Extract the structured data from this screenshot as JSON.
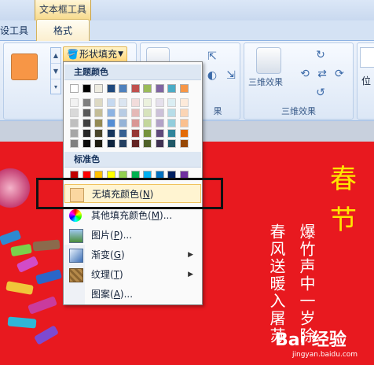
{
  "contextual_group": {
    "label": "文本框工具"
  },
  "tabs": {
    "left_partial": "设工具",
    "active": "格式"
  },
  "shape_fill": {
    "label": "形状填充",
    "swatch_color": "#f79646"
  },
  "ribbon_groups": {
    "shadow_label": "果",
    "three_d_label": "三维效果",
    "three_d_button": "三维效果",
    "position_button": "位"
  },
  "menu": {
    "theme_header": "主题颜色",
    "standard_header": "标准色",
    "theme_top_row": [
      "#ffffff",
      "#000000",
      "#eeece1",
      "#1f497d",
      "#4f81bd",
      "#c0504d",
      "#9bbb59",
      "#8064a2",
      "#4bacc6",
      "#f79646"
    ],
    "theme_columns": [
      [
        "#f2f2f2",
        "#d9d9d9",
        "#bfbfbf",
        "#a6a6a6",
        "#808080"
      ],
      [
        "#7f7f7f",
        "#595959",
        "#3f3f3f",
        "#262626",
        "#0c0c0c"
      ],
      [
        "#ddd9c3",
        "#c4bd97",
        "#948a54",
        "#4a452a",
        "#1e1c11"
      ],
      [
        "#c6d9f0",
        "#8db3e2",
        "#548dd4",
        "#17365d",
        "#0f243e"
      ],
      [
        "#dbe5f1",
        "#b8cce4",
        "#95b3d7",
        "#366092",
        "#244061"
      ],
      [
        "#f2dcdb",
        "#e5b9b7",
        "#d99694",
        "#953734",
        "#632423"
      ],
      [
        "#ebf1dd",
        "#d7e3bc",
        "#c3d69b",
        "#76923c",
        "#4f6128"
      ],
      [
        "#e5e0ec",
        "#ccc1d9",
        "#b2a2c7",
        "#5f497a",
        "#3f3151"
      ],
      [
        "#dbeef3",
        "#b7dde8",
        "#92cddc",
        "#31859b",
        "#205867"
      ],
      [
        "#fdeada",
        "#fbd5b5",
        "#fac08f",
        "#e36c09",
        "#974806"
      ]
    ],
    "standard_colors": [
      "#c00000",
      "#ff0000",
      "#ffc000",
      "#ffff00",
      "#92d050",
      "#00b050",
      "#00b0f0",
      "#0070c0",
      "#002060",
      "#7030a0"
    ],
    "items": [
      {
        "label": "无填充颜色(",
        "key": "N",
        "suffix": ")",
        "icon": "no-fill-icon"
      },
      {
        "label": "其他填充颜色(",
        "key": "M",
        "suffix": ")...",
        "icon": "color-wheel-icon"
      },
      {
        "label": "图片(",
        "key": "P",
        "suffix": ")...",
        "icon": "picture-icon"
      },
      {
        "label": "渐变(",
        "key": "G",
        "suffix": ")",
        "icon": "gradient-icon",
        "submenu": true
      },
      {
        "label": "纹理(",
        "key": "T",
        "suffix": ")",
        "icon": "texture-icon",
        "submenu": true
      },
      {
        "label": "图案(",
        "key": "A",
        "suffix": ")...",
        "icon": "pattern-icon"
      }
    ]
  },
  "document": {
    "title_char_1": "春",
    "title_char_2": "节",
    "couplet_right": "爆竹声中一岁除",
    "couplet_left": "春风送暖入屠苏"
  },
  "watermark": {
    "text": "Bai 经验",
    "sub": "jingyan.baidu.com"
  }
}
